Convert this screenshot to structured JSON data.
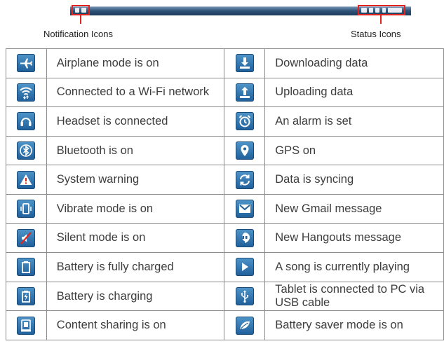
{
  "header": {
    "notification_label": "Notification Icons",
    "status_label": "Status Icons"
  },
  "rows": [
    {
      "left": {
        "icon": "airplane-icon",
        "text": "Airplane mode is on"
      },
      "right": {
        "icon": "download-icon",
        "text": "Downloading data"
      }
    },
    {
      "left": {
        "icon": "wifi-icon",
        "text": "Connected to a Wi-Fi network"
      },
      "right": {
        "icon": "upload-icon",
        "text": "Uploading data"
      }
    },
    {
      "left": {
        "icon": "headset-icon",
        "text": "Headset is connected"
      },
      "right": {
        "icon": "alarm-icon",
        "text": "An alarm is set"
      }
    },
    {
      "left": {
        "icon": "bluetooth-icon",
        "text": "Bluetooth is on"
      },
      "right": {
        "icon": "gps-icon",
        "text": "GPS on"
      }
    },
    {
      "left": {
        "icon": "warning-icon",
        "text": "System warning"
      },
      "right": {
        "icon": "sync-icon",
        "text": "Data is syncing"
      }
    },
    {
      "left": {
        "icon": "vibrate-icon",
        "text": "Vibrate mode is on"
      },
      "right": {
        "icon": "gmail-icon",
        "text": "New Gmail message"
      }
    },
    {
      "left": {
        "icon": "silent-icon",
        "text": "Silent mode is on"
      },
      "right": {
        "icon": "hangouts-icon",
        "text": "New Hangouts message"
      }
    },
    {
      "left": {
        "icon": "battery-full-icon",
        "text": "Battery is fully charged"
      },
      "right": {
        "icon": "play-icon",
        "text": "A song is currently playing"
      }
    },
    {
      "left": {
        "icon": "battery-charging-icon",
        "text": "Battery is charging"
      },
      "right": {
        "icon": "usb-icon",
        "text": "Tablet is connected to PC via USB cable"
      }
    },
    {
      "left": {
        "icon": "content-sharing-icon",
        "text": "Content sharing is on"
      },
      "right": {
        "icon": "battery-saver-icon",
        "text": "Battery saver mode is on"
      }
    }
  ]
}
